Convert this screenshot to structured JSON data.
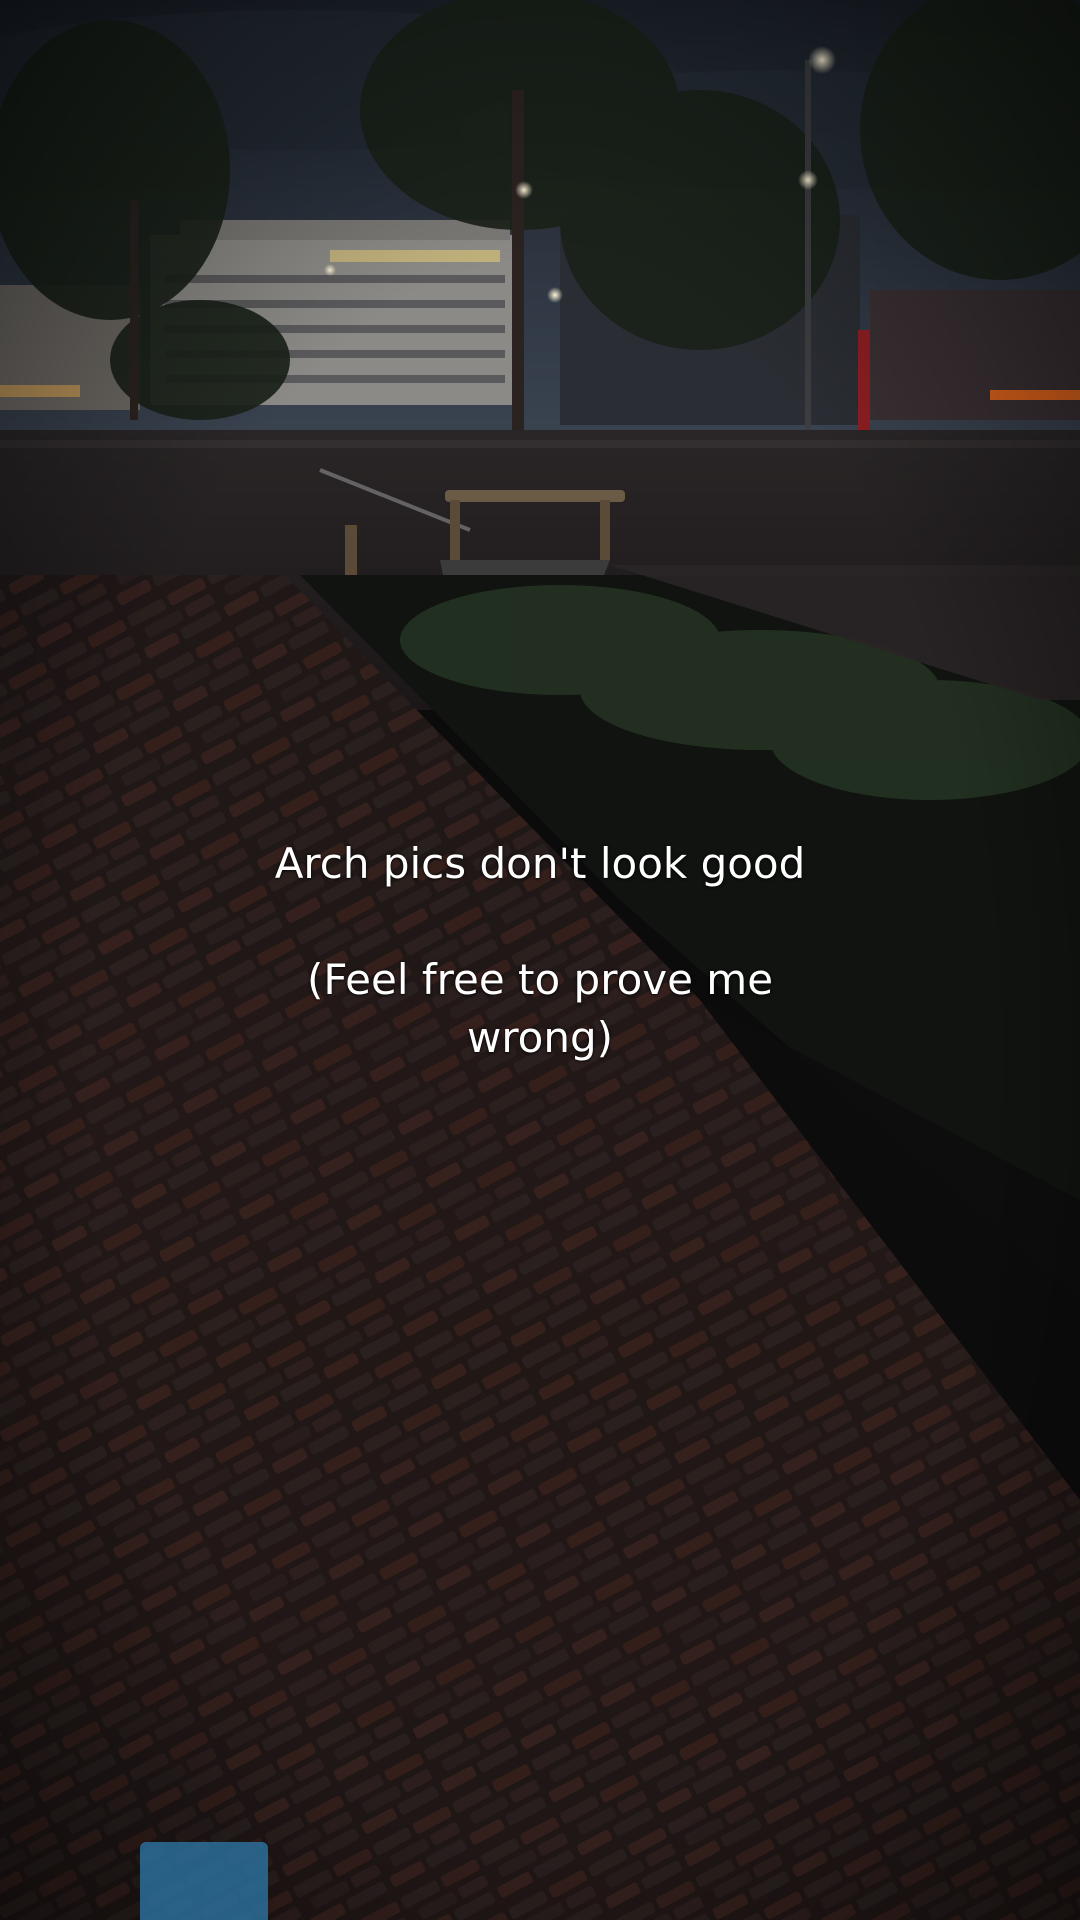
{
  "caption": {
    "line1": "Arch pics don't look good",
    "line2": "(Feel free to prove me",
    "line3": "wrong)"
  },
  "colors": {
    "sky": "#2b323d",
    "pavement": "#1d1614",
    "brick_accent": "#3a201c",
    "foliage": "#1e2a1c",
    "text": "#ffffff"
  }
}
